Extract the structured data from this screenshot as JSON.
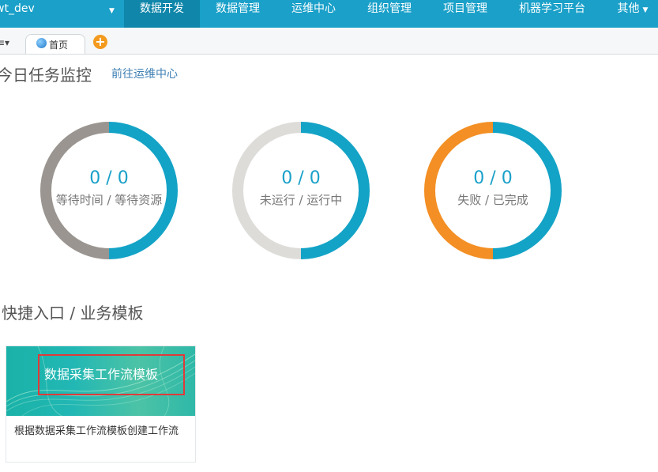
{
  "topnav": {
    "project": "wt_dev",
    "items": [
      {
        "label": "数据开发",
        "active": true
      },
      {
        "label": "数据管理"
      },
      {
        "label": "运维中心"
      },
      {
        "label": "组织管理"
      },
      {
        "label": "项目管理"
      },
      {
        "label": "机器学习平台"
      },
      {
        "label": "其他",
        "dropdown": true
      }
    ],
    "colors": {
      "bar": "#1aa0c9",
      "active": "#0f86aa"
    }
  },
  "tabbar": {
    "tabs": [
      {
        "label": "首页",
        "icon": "globe-icon"
      }
    ],
    "add_icon": "plus-circle-icon"
  },
  "monitor": {
    "title": "今日任务监控",
    "link": "前往运维中心",
    "donuts": [
      {
        "value": "0 / 0",
        "caption": "等待时间 / 等待资源",
        "colors": {
          "left": "#9a9590",
          "right": "#13a3c6"
        }
      },
      {
        "value": "0 / 0",
        "caption": "未运行 / 运行中",
        "colors": {
          "left": "#dddcd9",
          "right": "#13a3c6"
        }
      },
      {
        "value": "0 / 0",
        "caption": "失败 / 已完成",
        "colors": {
          "left": "#f38f24",
          "right": "#13a3c6"
        }
      }
    ]
  },
  "templates": {
    "title": "快捷入口 / 业务模板",
    "cards": [
      {
        "banner_title": "数据采集工作流模板",
        "description": "根据数据采集工作流模板创建工作流"
      }
    ]
  }
}
